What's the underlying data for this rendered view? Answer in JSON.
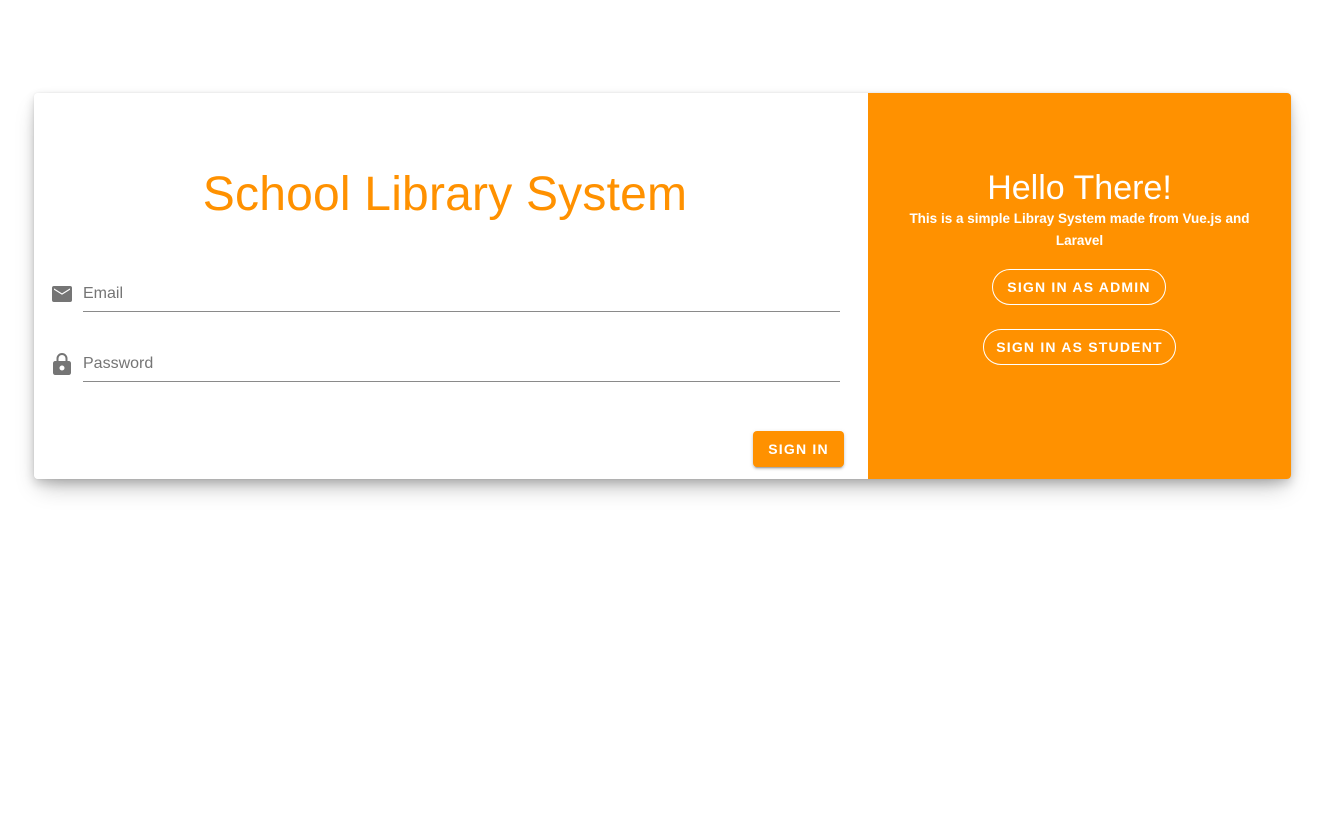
{
  "colors": {
    "accent": "#ff9100",
    "icon": "#757575",
    "white": "#ffffff"
  },
  "login_form": {
    "title": "School Library System",
    "email": {
      "icon": "mail-icon",
      "placeholder": "Email",
      "value": ""
    },
    "password": {
      "icon": "lock-icon",
      "placeholder": "Password",
      "value": ""
    },
    "submit_label": "SIGN IN"
  },
  "welcome_panel": {
    "title": "Hello There!",
    "subtitle": "This is a simple Libray System made from Vue.js and Laravel",
    "admin_button_label": "SIGN IN AS ADMIN",
    "student_button_label": "SIGN IN AS STUDENT"
  }
}
